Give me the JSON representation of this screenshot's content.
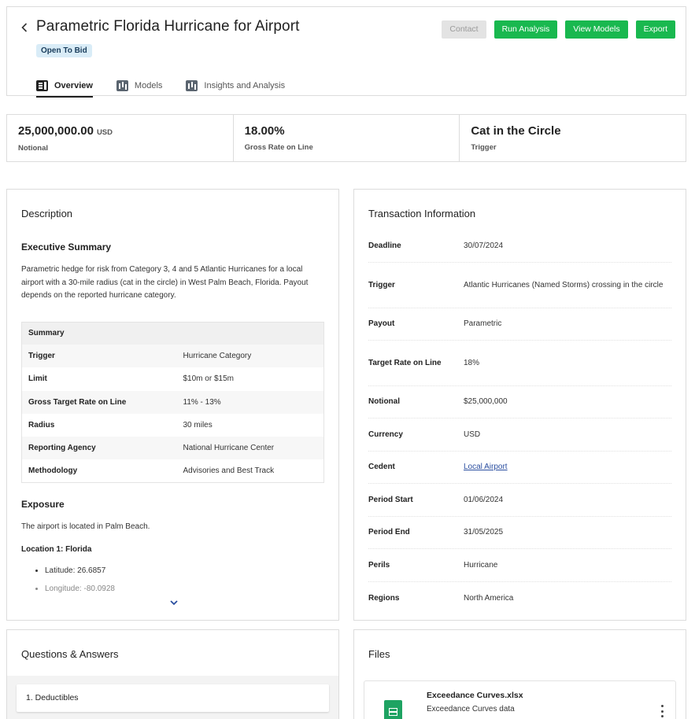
{
  "header": {
    "title": "Parametric Florida Hurricane for Airport",
    "status": "Open To Bid",
    "actions": {
      "contact": "Contact",
      "run_analysis": "Run Analysis",
      "view_models": "View Models",
      "export": "Export"
    },
    "tabs": [
      {
        "label": "Overview",
        "icon": "overview-icon",
        "active": true
      },
      {
        "label": "Models",
        "icon": "models-icon",
        "active": false
      },
      {
        "label": "Insights and Analysis",
        "icon": "insights-icon",
        "active": false
      }
    ]
  },
  "metrics": [
    {
      "value": "25,000,000.00",
      "unit": "USD",
      "label": "Notional"
    },
    {
      "value": "18.00%",
      "label": "Gross Rate on Line"
    },
    {
      "value": "Cat in the Circle",
      "label": "Trigger"
    }
  ],
  "description": {
    "title": "Description",
    "executive_summary_title": "Executive Summary",
    "executive_summary": "Parametric hedge for risk from Category 3, 4 and 5 Atlantic Hurricanes for a local airport with a 30-mile radius (cat in the circle) in West Palm Beach, Florida. Payout depends on the reported hurricane category.",
    "summary_header": "Summary",
    "summary_rows": [
      {
        "key": "Trigger",
        "value": "Hurricane Category"
      },
      {
        "key": "Limit",
        "value": "$10m or $15m"
      },
      {
        "key": "Gross Target Rate on Line",
        "value": "11% - 13%"
      },
      {
        "key": "Radius",
        "value": "30 miles"
      },
      {
        "key": "Reporting Agency",
        "value": "National Hurricane Center"
      },
      {
        "key": "Methodology",
        "value": "Advisories and Best Track"
      }
    ],
    "exposure_title": "Exposure",
    "exposure_text": "The airport is located in Palm Beach.",
    "location_title": "Location 1: Florida",
    "location_items": [
      "Latitude: 26.6857",
      "Longitude: -80.0928"
    ]
  },
  "transaction": {
    "title": "Transaction Information",
    "rows": [
      {
        "key": "Deadline",
        "value": "30/07/2024"
      },
      {
        "key": "Trigger",
        "value": "Atlantic Hurricanes (Named Storms) crossing in the circle"
      },
      {
        "key": "Payout",
        "value": "Parametric"
      },
      {
        "key": "Target Rate on Line",
        "value": "18%"
      },
      {
        "key": "Notional",
        "value": "$25,000,000"
      },
      {
        "key": "Currency",
        "value": "USD"
      },
      {
        "key": "Cedent",
        "value": "Local Airport",
        "link": true
      },
      {
        "key": "Period Start",
        "value": "01/06/2024"
      },
      {
        "key": "Period End",
        "value": "31/05/2025"
      },
      {
        "key": "Perils",
        "value": "Hurricane"
      },
      {
        "key": "Regions",
        "value": "North America"
      }
    ]
  },
  "qa": {
    "title": "Questions & Answers",
    "items": [
      "1. Deductibles"
    ]
  },
  "files": {
    "title": "Files",
    "items": [
      {
        "name": "Exceedance Curves.xlsx",
        "description": "Exceedance Curves data",
        "icon": "spreadsheet-icon"
      }
    ]
  }
}
